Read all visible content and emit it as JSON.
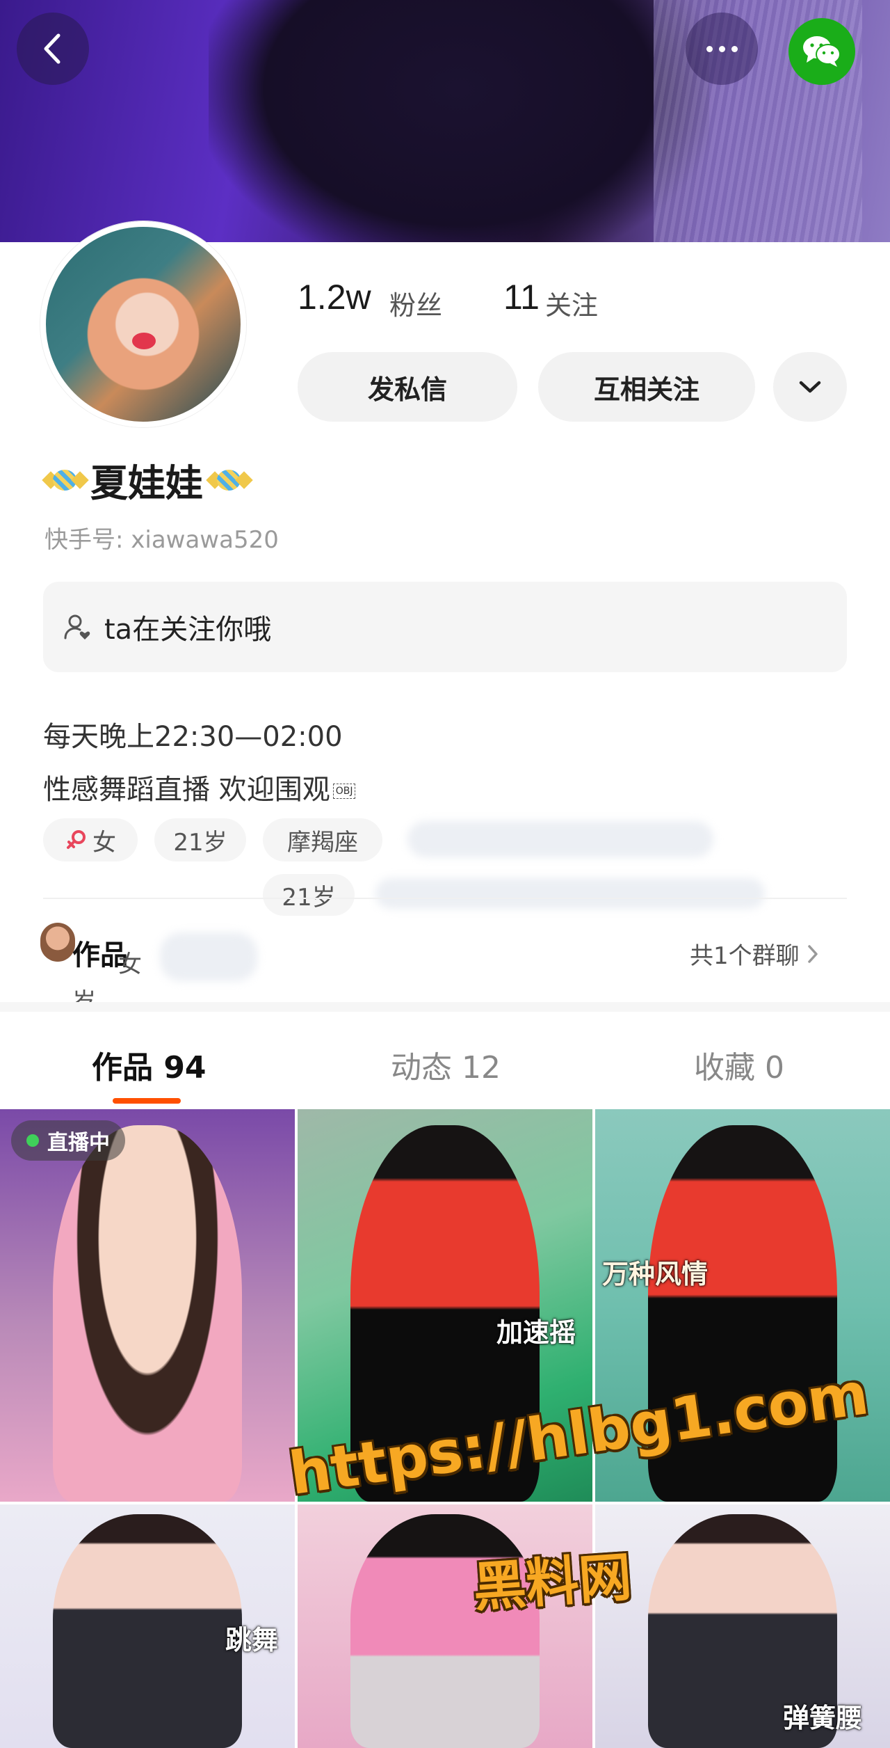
{
  "stats": {
    "fans_count": "1.2w",
    "fans_label": "粉丝",
    "following_count": "11",
    "following_label": "关注"
  },
  "actions": {
    "message_label": "发私信",
    "mutual_follow_label": "互相关注"
  },
  "profile": {
    "name": "夏娃娃",
    "kuaishou_id": "快手号: xiawawa520",
    "follow_notice": "ta在关注你哦",
    "bio_line1": "每天晚上22:30—02:00",
    "bio_line2": "性感舞蹈直播 欢迎围观",
    "bio_obj": "OBJ",
    "tags": [
      "女",
      "21岁",
      "摩羯座"
    ],
    "tag_overlap_age": "21岁",
    "overlap_gender": "女",
    "overlap_age_char": "岁"
  },
  "works_row": {
    "label": "作品",
    "group_link": "共1个群聊"
  },
  "tabs": [
    {
      "label": "作品 94"
    },
    {
      "label": "动态 12"
    },
    {
      "label": "收藏 0"
    }
  ],
  "grid": {
    "live_badge": "直播中",
    "captions": [
      "加速摇",
      "万种风情",
      "跳舞",
      "弹簧腰"
    ]
  },
  "watermark": {
    "url": "https://hlbg1.com",
    "name": "黑料网"
  },
  "colors": {
    "accent": "#ff5000",
    "wechat": "#1aad19",
    "live_dot": "#3fd05a",
    "watermark": "#f7a823"
  },
  "icons": [
    "back-icon",
    "more-icon",
    "wechat-icon",
    "chevron-down-icon",
    "user-heart-icon",
    "female-icon",
    "chevron-right-icon",
    "candy-icon"
  ]
}
